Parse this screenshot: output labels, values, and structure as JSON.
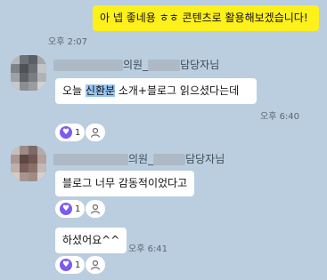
{
  "messages": {
    "my_message": {
      "text": "아 넵 좋네용 ㅎㅎ 콘텐츠로 활용해보겠습니다!",
      "time": "오후 2:07"
    },
    "block1": {
      "sender_mid": "의원_",
      "sender_suffix": "담당자님",
      "text_before": "오늘 ",
      "text_highlight": "신환분",
      "text_after": " 소개+블로그 읽으셨다는데",
      "time": "오후 6:40",
      "reaction_count": "1"
    },
    "block2": {
      "sender_mid": "의원_",
      "sender_suffix": "담당자님",
      "text": "블로그 너무 감동적이었다고",
      "reaction_count": "1",
      "followup_text": "하셨어요^^",
      "followup_time": "오후 6:41",
      "followup_reaction_count": "1"
    }
  },
  "icons": {
    "reaction": "like-icon",
    "add_reaction": "person-icon"
  },
  "colors": {
    "background": "#bacee0",
    "my_bubble": "#fef01b",
    "other_bubble": "#ffffff",
    "reaction_accent": "#7b5cf0",
    "highlight": "#98c6f1"
  }
}
